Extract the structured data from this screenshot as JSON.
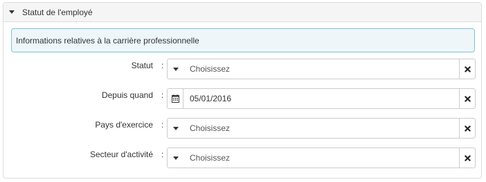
{
  "panel": {
    "title": "Statut de l'employé",
    "info": "Informations relatives à la carrière professionnelle"
  },
  "fields": [
    {
      "label": "Statut",
      "value": "Choisissez",
      "kind": "select",
      "icon": "chevron-down-icon",
      "clear_icon": "clear-icon"
    },
    {
      "label": "Depuis quand",
      "value": "05/01/2016",
      "kind": "date",
      "icon": "calendar-icon",
      "clear_icon": "clear-icon"
    },
    {
      "label": "Pays d'exercice",
      "value": "Choisissez",
      "kind": "select",
      "icon": "chevron-down-icon",
      "clear_icon": "clear-icon"
    },
    {
      "label": "Secteur d'activité",
      "value": "Choisissez",
      "kind": "select",
      "icon": "chevron-down-icon",
      "clear_icon": "clear-icon"
    }
  ],
  "colon": ":",
  "colors": {
    "info_border": "#7cc3d6",
    "info_bg": "#eef6f9",
    "header_bg": "#f5f5f5"
  }
}
